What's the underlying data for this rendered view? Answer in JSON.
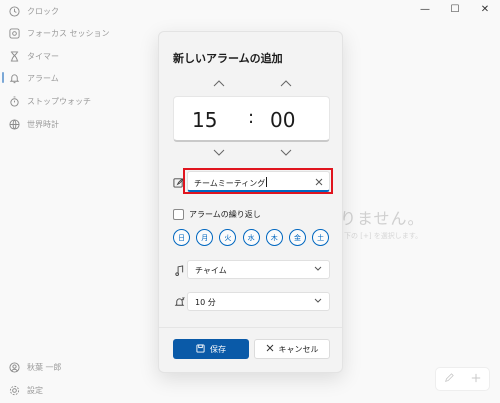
{
  "sidebar": {
    "items": [
      {
        "label": "クロック",
        "icon": "clock-icon"
      },
      {
        "label": "フォーカス セッション",
        "icon": "focus-icon"
      },
      {
        "label": "タイマー",
        "icon": "hourglass-icon"
      },
      {
        "label": "アラーム",
        "icon": "bell-icon"
      },
      {
        "label": "ストップウォッチ",
        "icon": "stopwatch-icon"
      },
      {
        "label": "世界時計",
        "icon": "globe-icon"
      }
    ],
    "user": "秋葉 一郎",
    "settings": "設定"
  },
  "window_controls": {
    "minimize": "—",
    "maximize": "☐",
    "close": "✕"
  },
  "main": {
    "empty_title": "りません。",
    "empty_hint": "下の [+] を選択します。"
  },
  "dialog": {
    "title": "新しいアラームの追加",
    "hour": "15",
    "separator": ":",
    "minute": "00",
    "name_value": "チームミーティング",
    "repeat_label": "アラームの繰り返し",
    "days": [
      "日",
      "月",
      "火",
      "水",
      "木",
      "金",
      "土"
    ],
    "sound_value": "チャイム",
    "snooze_value": "10 分",
    "save_label": "保存",
    "cancel_label": "キャンセル"
  },
  "colors": {
    "accent": "#0067c0",
    "highlight": "#e0141e"
  }
}
